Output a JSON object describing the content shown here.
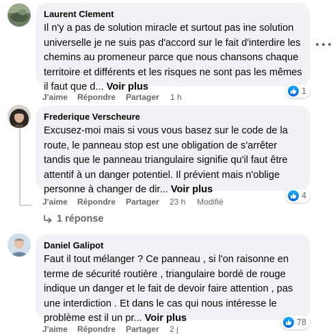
{
  "comments": [
    {
      "author": "Laurent Clement",
      "text": "Il n'y a pas de solution miracle et surtout pas ine solution universelle je ne suis pas d'accord sur le fait d'interdire les chemins au promeneur parce que nous chansons chaque territoire et différents et les risques ne sont pas les mêmes il faut que d...",
      "see_more": "Voir plus",
      "like_label": "J'aime",
      "reply_label": "Répondre",
      "share_label": "Partager",
      "time": "1 h",
      "reaction_count": "1"
    },
    {
      "author": "Frederique Verscheure",
      "text": "Excusez-moi mais si vous vous basez sur le code de la route, le panneau stop est une obligation de s'arrêter tandis que le panneau triangulaire signifie qu'il faut être attentif à un danger potentiel. Il prévient mais n'oblige personne à changer de dir...",
      "see_more": "Voir plus",
      "like_label": "J'aime",
      "reply_label": "Répondre",
      "share_label": "Partager",
      "time": "23 h",
      "modified": "Modifié",
      "reaction_count": "4",
      "replies_label": "1 réponse"
    },
    {
      "author": "Daniel Galipot",
      "text": "Faut il tout mélanger ? Ce panneau , si l'on raisonne en terme de sécurité routière , triangulaire bordé de rouge indique un danger et le fait de devoir faire attention , pas une interdiction . Et dans le cas qui nous intéresse le problème est il un pr...",
      "see_more": "Voir plus",
      "like_label": "J'aime",
      "reply_label": "Répondre",
      "share_label": "Partager",
      "time": "2 j",
      "reaction_count": "78"
    }
  ],
  "icons": {
    "like": "like-thumb-icon",
    "reply_arrow": "reply-arrow-icon",
    "more": "more-dots-icon"
  },
  "colors": {
    "like_blue": "#0866ff",
    "bubble": "#f0f2f5",
    "meta_gray": "#65676b"
  }
}
